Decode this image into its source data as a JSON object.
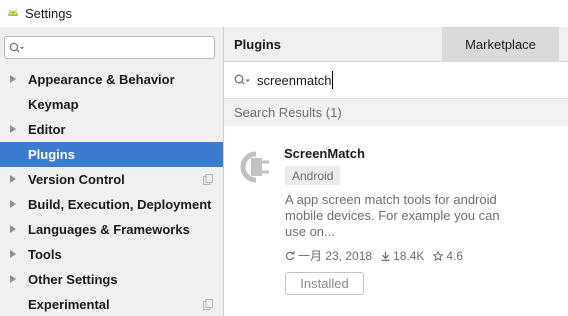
{
  "window": {
    "title": "Settings",
    "icon": "android-icon"
  },
  "sidebar": {
    "search": {
      "value": "",
      "placeholder": ""
    },
    "items": [
      {
        "label": "Appearance & Behavior",
        "expandable": true,
        "selected": false,
        "copy_icon": false
      },
      {
        "label": "Keymap",
        "expandable": false,
        "selected": false,
        "copy_icon": false
      },
      {
        "label": "Editor",
        "expandable": true,
        "selected": false,
        "copy_icon": false
      },
      {
        "label": "Plugins",
        "expandable": false,
        "selected": true,
        "copy_icon": false
      },
      {
        "label": "Version Control",
        "expandable": true,
        "selected": false,
        "copy_icon": true
      },
      {
        "label": "Build, Execution, Deployment",
        "expandable": true,
        "selected": false,
        "copy_icon": false
      },
      {
        "label": "Languages & Frameworks",
        "expandable": true,
        "selected": false,
        "copy_icon": false
      },
      {
        "label": "Tools",
        "expandable": true,
        "selected": false,
        "copy_icon": false
      },
      {
        "label": "Other Settings",
        "expandable": true,
        "selected": false,
        "copy_icon": false
      },
      {
        "label": "Experimental",
        "expandable": false,
        "selected": false,
        "copy_icon": true
      }
    ]
  },
  "main": {
    "title": "Plugins",
    "tabs": [
      {
        "label": "Marketplace",
        "active": true
      }
    ],
    "search": {
      "value": "screenmatch",
      "placeholder": ""
    },
    "results_header": "Search Results (1)",
    "plugin": {
      "name": "ScreenMatch",
      "tag": "Android",
      "description": "A app screen match tools for android mobile devices. For example you can use on...",
      "date": "一月 23, 2018",
      "downloads": "18.4K",
      "rating": "4.6",
      "button_label": "Installed"
    }
  },
  "colors": {
    "selection": "#3d7bd1",
    "sidebar_bg": "#f0f0f0",
    "tab_active_bg": "#dadada",
    "muted_text": "#6e6e6e"
  }
}
